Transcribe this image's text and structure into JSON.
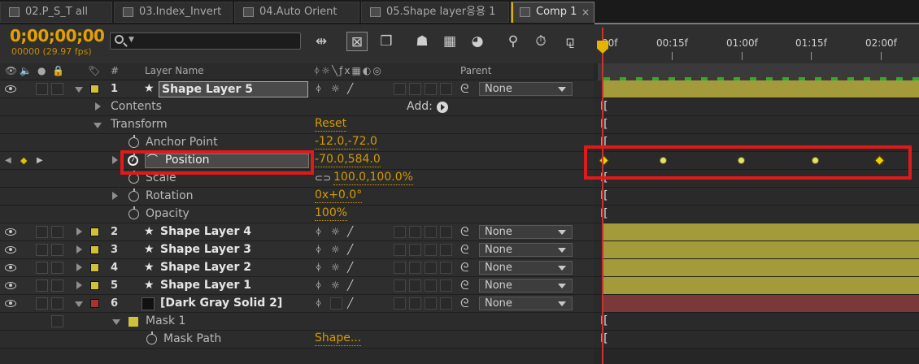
{
  "tabs": [
    {
      "label": "02.P_S_T all"
    },
    {
      "label": "03.Index_Invert"
    },
    {
      "label": "04.Auto Orient"
    },
    {
      "label": "05.Shape layer응용 1"
    },
    {
      "label": "Comp 1",
      "active": true,
      "close": "×"
    }
  ],
  "toolbar": {
    "timecode": "0;00;00;00",
    "fps": "00000 (29.97 fps)",
    "tools": [
      "composition-mini-flowchart",
      "draft-3d",
      "hide-shy-layers",
      "frame-blending",
      "motion-blur",
      "brainstorm",
      "auto-keyframe",
      "graph-editor",
      "live-update",
      "draft-preview"
    ]
  },
  "header": {
    "label_col": "#",
    "layer_name": "Layer Name",
    "parent": "Parent"
  },
  "layers": [
    {
      "num": "1",
      "name": "Shape Layer 5",
      "parent": "None",
      "color": "#cfc13a"
    },
    {
      "num": "2",
      "name": "Shape Layer 4",
      "parent": "None",
      "color": "#cfc13a"
    },
    {
      "num": "3",
      "name": "Shape Layer 3",
      "parent": "None",
      "color": "#cfc13a"
    },
    {
      "num": "4",
      "name": "Shape Layer 2",
      "parent": "None",
      "color": "#cfc13a"
    },
    {
      "num": "5",
      "name": "Shape Layer 1",
      "parent": "None",
      "color": "#cfc13a"
    },
    {
      "num": "6",
      "name": "[Dark Gray Solid 2]",
      "parent": "None",
      "color": "#a63232"
    }
  ],
  "properties": {
    "contents": "Contents",
    "add_label": "Add:",
    "transform": "Transform",
    "reset": "Reset",
    "anchor_point": {
      "label": "Anchor Point",
      "value": "-12.0,-72.0"
    },
    "position": {
      "label": "Position",
      "value": "-70.0,584.0"
    },
    "scale": {
      "label": "Scale",
      "value": "100.0,100.0%"
    },
    "rotation": {
      "label": "Rotation",
      "value": "0x+0.0°"
    },
    "opacity": {
      "label": "Opacity",
      "value": "100%"
    },
    "mask1": "Mask 1",
    "mask_path": {
      "label": "Mask Path",
      "value": "Shape..."
    }
  },
  "timeline": {
    "ticks": [
      "00f",
      "00:15f",
      "01:00f",
      "01:15f",
      "02:00f"
    ]
  },
  "colors": {
    "accent": "#e3a000",
    "highlight_box": "#e01a1a",
    "shape_bar": "#a39b3a",
    "solid_bar": "#7a3838"
  }
}
